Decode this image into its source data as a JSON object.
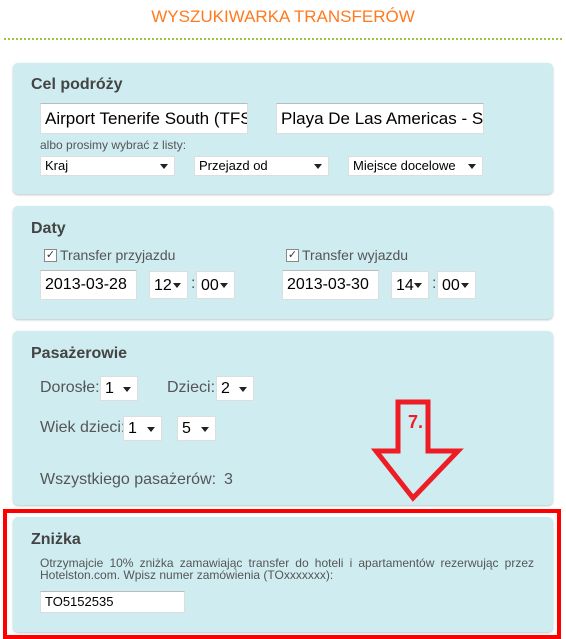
{
  "title": "WYSZUKIWARKA TRANSFERÓW",
  "destination": {
    "heading": "Cel podróży",
    "from_value": "Airport Tenerife South (TFS) - Spain",
    "to_value": "Playa De Las Americas - Spain",
    "hint": "albo prosimy wybrać z listy:",
    "country": "Kraj",
    "from_select": "Przejazd od",
    "to_select": "Miejsce docelowe"
  },
  "dates": {
    "heading": "Daty",
    "arrival_label": "Transfer przyjazdu",
    "arrival_date": "2013-03-28",
    "arrival_hour": "12",
    "arrival_min": "00",
    "departure_label": "Transfer wyjazdu",
    "departure_date": "2013-03-30",
    "departure_hour": "14",
    "departure_min": "00",
    "colon": ":"
  },
  "passengers": {
    "heading": "Pasażerowie",
    "adults_label": "Dorosłe:",
    "adults": "1",
    "children_label": "Dzieci:",
    "children": "2",
    "ages_label": "Wiek dzieci:",
    "age1": "1",
    "age2": "5",
    "total_label": "Wszystkiego pasażerów:",
    "total": "3"
  },
  "discount": {
    "heading": "Zniżka",
    "text": "Otrzymajcie 10% zniżka zamawiając transfer do hoteli i apartamentów rezerwując przez Hotelston.com. Wpisz numer zamówienia (TOxxxxxxx):",
    "code": "TO5152535"
  },
  "annotation": {
    "step": "7.",
    "color": "#ee1c25"
  }
}
